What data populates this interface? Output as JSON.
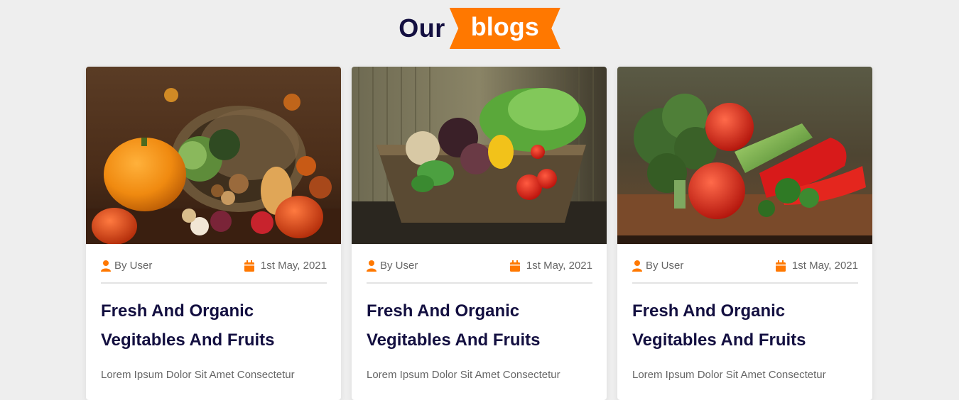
{
  "heading": {
    "prefix": "Our",
    "highlight": "blogs"
  },
  "colors": {
    "accent": "#ff7800",
    "title": "#130f40",
    "text": "#666666",
    "background": "#eeeeee"
  },
  "cards": [
    {
      "image": "pumpkin-basket-image",
      "author": "By User",
      "date": "1st May, 2021",
      "title": "Fresh And Organic Vegitables And Fruits",
      "text": "Lorem Ipsum Dolor Sit Amet Consectetur"
    },
    {
      "image": "vegetable-basket-image",
      "author": "By User",
      "date": "1st May, 2021",
      "title": "Fresh And Organic Vegitables And Fruits",
      "text": "Lorem Ipsum Dolor Sit Amet Consectetur"
    },
    {
      "image": "broccoli-tomatoes-image",
      "author": "By User",
      "date": "1st May, 2021",
      "title": "Fresh And Organic Vegitables And Fruits",
      "text": "Lorem Ipsum Dolor Sit Amet Consectetur"
    }
  ]
}
